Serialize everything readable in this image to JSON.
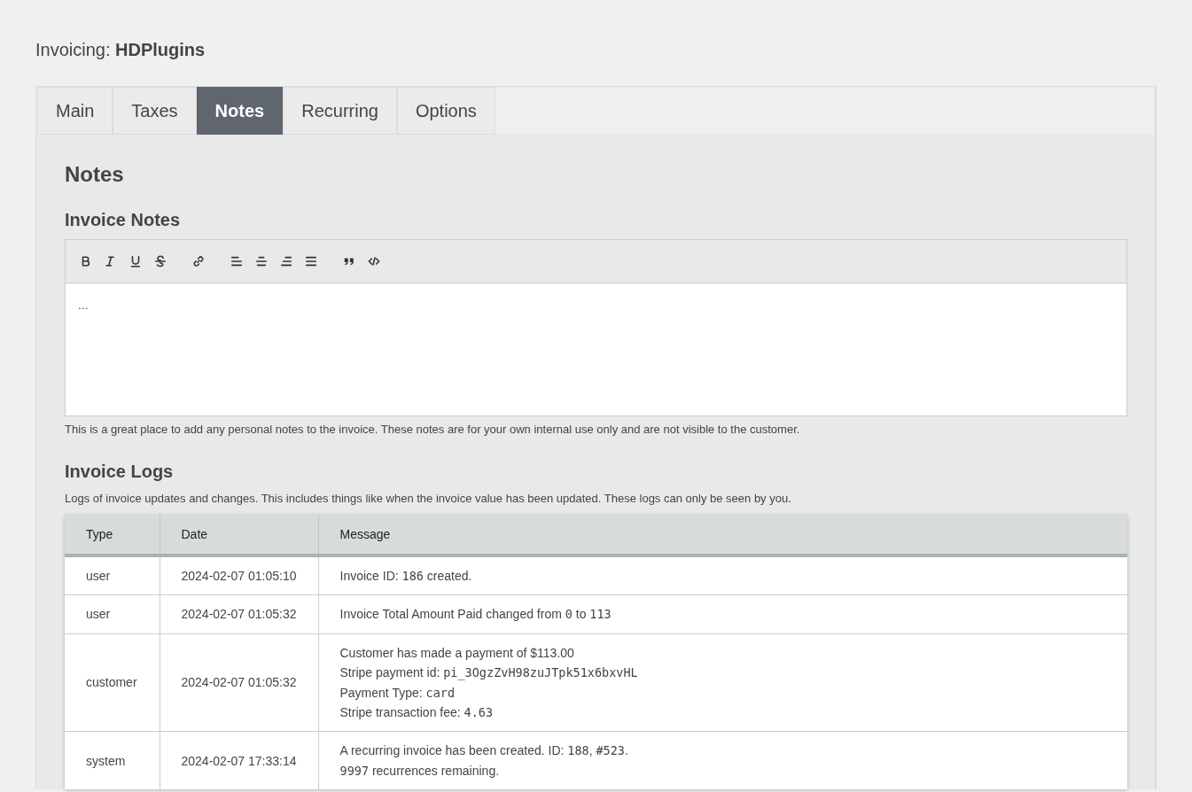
{
  "page": {
    "title": "Invoicing: **HDPlugins**"
  },
  "tabs": [
    {
      "label": "Main",
      "selected": false
    },
    {
      "label": "Taxes",
      "selected": false
    },
    {
      "label": "Notes",
      "selected": true
    },
    {
      "label": "Recurring",
      "selected": false
    },
    {
      "label": "Options",
      "selected": false
    }
  ],
  "section_heading": "Notes",
  "invoice_notes": {
    "heading": "Invoice Notes",
    "editor": {
      "value": "..."
    },
    "help_text": "This is a great place to add any personal notes to the invoice. These notes are for your own internal use only and are not visible to the customer."
  },
  "invoice_logs": {
    "heading": "Invoice Logs",
    "description": "Logs of invoice updates and changes. This includes things like when the invoice value has been updated. These logs can only be seen by you.",
    "table": {
      "columns": [
        "Type",
        "Date",
        "Message"
      ],
      "rows": [
        {
          "type": "user",
          "date": "2024-02-07 01:05:10",
          "message": [
            [
              {
                "kind": "text",
                "text": "Invoice ID: "
              },
              {
                "kind": "code",
                "text": "186"
              },
              {
                "kind": "text",
                "text": " created."
              }
            ]
          ]
        },
        {
          "type": "user",
          "date": "2024-02-07 01:05:32",
          "message": [
            [
              {
                "kind": "text",
                "text": "Invoice Total Amount Paid changed from "
              },
              {
                "kind": "code",
                "text": "0"
              },
              {
                "kind": "text",
                "text": " to "
              },
              {
                "kind": "code",
                "text": "113"
              }
            ]
          ]
        },
        {
          "type": "customer",
          "date": "2024-02-07 01:05:32",
          "message": [
            [
              {
                "kind": "text",
                "text": "Customer has made a payment of $113.00"
              }
            ],
            [
              {
                "kind": "text",
                "text": "Stripe payment id: "
              },
              {
                "kind": "code",
                "text": "pi_3OgzZvH98zuJTpk51x6bxvHL"
              }
            ],
            [
              {
                "kind": "text",
                "text": "Payment Type: "
              },
              {
                "kind": "code",
                "text": "card"
              }
            ],
            [
              {
                "kind": "text",
                "text": "Stripe transaction fee: "
              },
              {
                "kind": "code",
                "text": "4.63"
              }
            ]
          ]
        },
        {
          "type": "system",
          "date": "2024-02-07 17:33:14",
          "message": [
            [
              {
                "kind": "text",
                "text": "A recurring invoice has been created. ID: "
              },
              {
                "kind": "code",
                "text": "188"
              },
              {
                "kind": "text",
                "text": ", "
              },
              {
                "kind": "code",
                "text": "#523"
              },
              {
                "kind": "text",
                "text": "."
              }
            ],
            [
              {
                "kind": "code",
                "text": "9997"
              },
              {
                "kind": "text",
                "text": " recurrences remaining."
              }
            ]
          ]
        }
      ]
    }
  }
}
